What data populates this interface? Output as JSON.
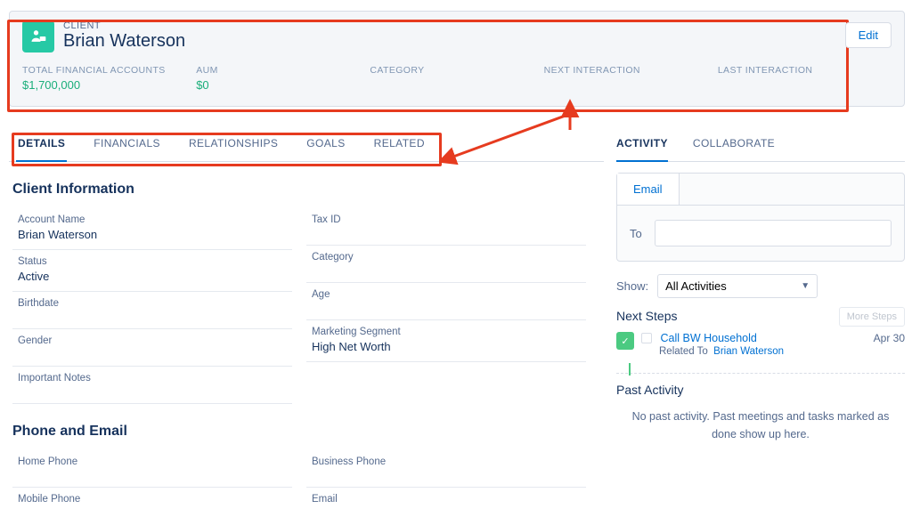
{
  "header": {
    "object_label": "CLIENT",
    "object_name": "Brian Waterson",
    "edit": "Edit"
  },
  "stats": {
    "s1": {
      "label": "TOTAL FINANCIAL ACCOUNTS",
      "value": "$1,700,000"
    },
    "s2": {
      "label": "AUM",
      "value": "$0"
    },
    "s3": {
      "label": "CATEGORY",
      "value": ""
    },
    "s4": {
      "label": "NEXT INTERACTION",
      "value": ""
    },
    "s5": {
      "label": "LAST INTERACTION",
      "value": ""
    }
  },
  "tabs": {
    "details": "DETAILS",
    "financials": "FINANCIALS",
    "relationships": "RELATIONSHIPS",
    "goals": "GOALS",
    "related": "RELATED"
  },
  "sections": {
    "client_info": "Client Information",
    "phone_email": "Phone and Email"
  },
  "fields": {
    "account_name": {
      "label": "Account Name",
      "value": "Brian Waterson"
    },
    "status": {
      "label": "Status",
      "value": "Active"
    },
    "birthdate": {
      "label": "Birthdate",
      "value": ""
    },
    "gender": {
      "label": "Gender",
      "value": ""
    },
    "important_notes": {
      "label": "Important Notes",
      "value": ""
    },
    "tax_id": {
      "label": "Tax ID",
      "value": ""
    },
    "category": {
      "label": "Category",
      "value": ""
    },
    "age": {
      "label": "Age",
      "value": ""
    },
    "marketing_segment": {
      "label": "Marketing Segment",
      "value": "High Net Worth"
    },
    "home_phone": {
      "label": "Home Phone",
      "value": ""
    },
    "mobile_phone": {
      "label": "Mobile Phone",
      "value": ""
    },
    "business_phone": {
      "label": "Business Phone",
      "value": ""
    },
    "email": {
      "label": "Email",
      "value": ""
    }
  },
  "right": {
    "tab_activity": "ACTIVITY",
    "tab_collaborate": "COLLABORATE",
    "email_tab": "Email",
    "to": "To",
    "show": "Show:",
    "all_activities": "All Activities",
    "next_steps": "Next Steps",
    "more_steps": "More Steps",
    "step_title": "Call BW Household",
    "step_date": "Apr 30",
    "related_to": "Related To",
    "related_to_name": "Brian Waterson",
    "past_activity": "Past Activity",
    "empty": "No past activity. Past meetings and tasks marked as done show up here."
  }
}
